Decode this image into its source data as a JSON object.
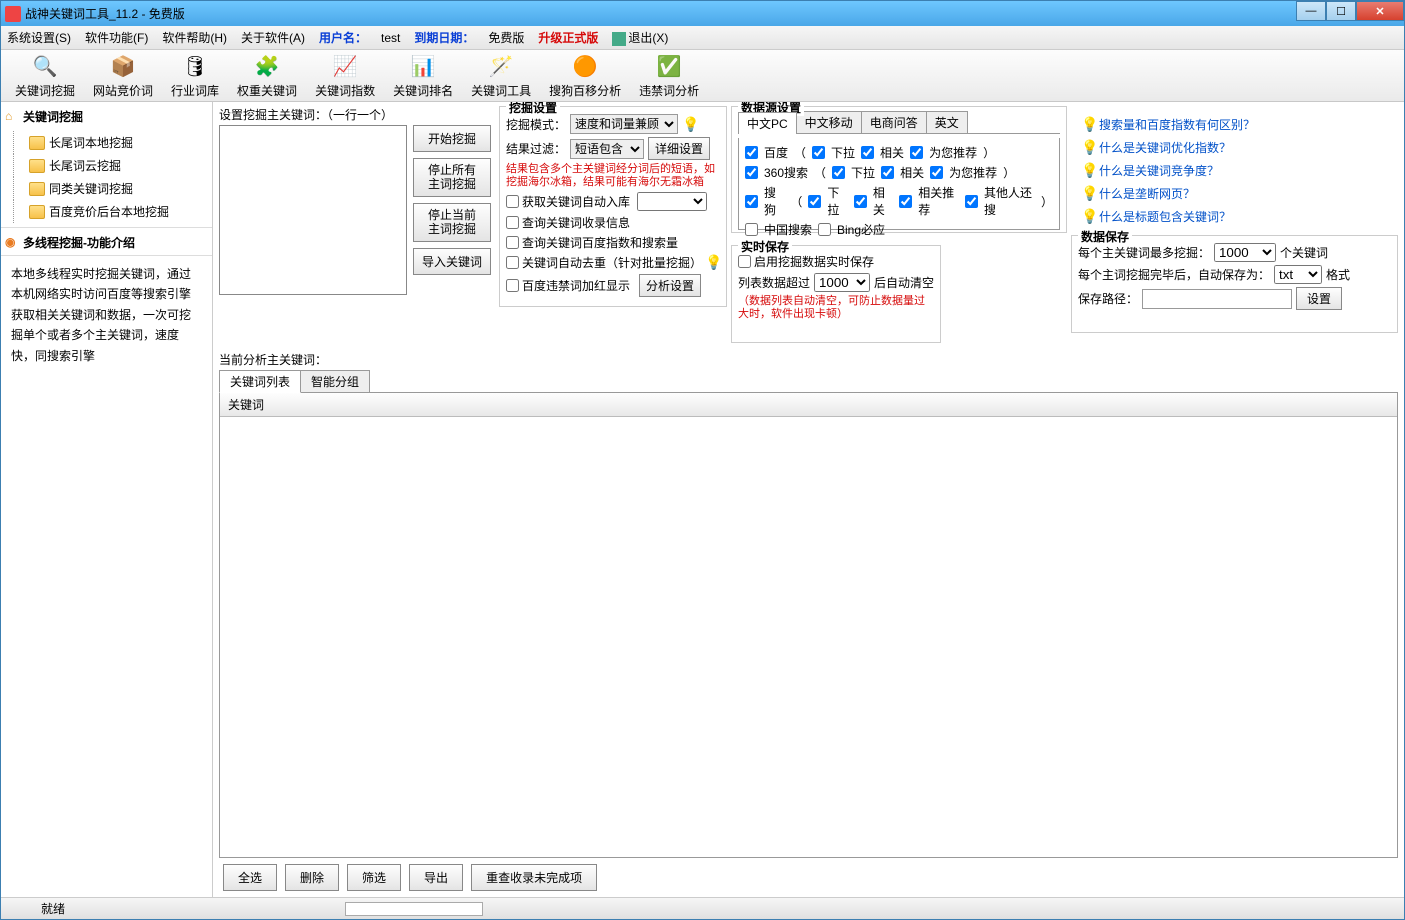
{
  "window": {
    "title": "战神关键词工具_11.2 - 免费版"
  },
  "menubar": {
    "sys": "系统设置(S)",
    "func": "软件功能(F)",
    "help": "软件帮助(H)",
    "about": "关于软件(A)",
    "user_label": "用户名：",
    "user_value": "test",
    "expire_label": "到期日期：",
    "edition": "免费版",
    "upgrade": "升级正式版",
    "exit": "退出(X)"
  },
  "toolbar": [
    {
      "name": "keyword-mining",
      "label": "关键词挖掘",
      "icon": "🔍"
    },
    {
      "name": "site-bid",
      "label": "网站竞价词",
      "icon": "📦"
    },
    {
      "name": "industry-db",
      "label": "行业词库",
      "icon": "🛢"
    },
    {
      "name": "weight-keyword",
      "label": "权重关键词",
      "icon": "🧩"
    },
    {
      "name": "keyword-index",
      "label": "关键词指数",
      "icon": "📈"
    },
    {
      "name": "keyword-rank",
      "label": "关键词排名",
      "icon": "📊"
    },
    {
      "name": "keyword-tool",
      "label": "关键词工具",
      "icon": "🪄"
    },
    {
      "name": "sogou-analysis",
      "label": "搜狗百移分析",
      "icon": "🟠"
    },
    {
      "name": "banned-analysis",
      "label": "违禁词分析",
      "icon": "✅"
    }
  ],
  "sidebar": {
    "title": "关键词挖掘",
    "tree": [
      "长尾词本地挖掘",
      "长尾词云挖掘",
      "同类关键词挖掘",
      "百度竞价后台本地挖掘"
    ],
    "sec2": "多线程挖掘-功能介绍",
    "desc": "本地多线程实时挖掘关键词，通过本机网络实时访问百度等搜索引擎获取相关关键词和数据，一次可挖掘单个或者多个主关键词，速度快，同搜索引擎"
  },
  "col1": {
    "label": "设置挖掘主关键词：（一行一个）",
    "btn_start": "开始挖掘",
    "btn_stop_all": "停止所有\n主词挖掘",
    "btn_stop_cur": "停止当前\n主词挖掘",
    "btn_import": "导入关键词"
  },
  "mining": {
    "legend": "挖掘设置",
    "mode_label": "挖掘模式：",
    "mode_value": "速度和词量兼顾",
    "filter_label": "结果过滤：",
    "filter_value": "短语包含",
    "detail_btn": "详细设置",
    "note": "结果包含多个主关键词经分词后的短语，如挖掘海尔冰箱，结果可能有海尔无霜冰箱",
    "chk_auto_in": "获取关键词自动入库",
    "chk_query_inc": "查询关键词收录信息",
    "chk_query_idx": "查询关键词百度指数和搜索量",
    "chk_dedup": "关键词自动去重（针对批量挖掘）",
    "chk_ban_red": "百度违禁词加红显示",
    "analyze_btn": "分析设置"
  },
  "datasource": {
    "legend": "数据源设置",
    "tabs": [
      "中文PC",
      "中文移动",
      "电商问答",
      "英文"
    ],
    "rows": [
      {
        "main": "百度",
        "dd": true,
        "opts": [
          "下拉",
          "相关",
          "为您推荐"
        ]
      },
      {
        "main": "360搜索",
        "dd": true,
        "opts": [
          "下拉",
          "相关",
          "为您推荐"
        ]
      },
      {
        "main": "搜狗",
        "dd": true,
        "opts": [
          "下拉",
          "相关",
          "相关推荐",
          "其他人还搜"
        ]
      },
      {
        "main": "中国搜索",
        "dd": false,
        "opts": [
          "Bing必应"
        ]
      }
    ]
  },
  "realtime": {
    "legend": "实时保存",
    "chk": "启用挖掘数据实时保存",
    "row2a": "列表数据超过",
    "row2val": "1000",
    "row2b": "后自动清空",
    "note": "（数据列表自动清空，可防止数据量过大时，软件出现卡顿）"
  },
  "datasave": {
    "legend": "数据保存",
    "r1a": "每个主关键词最多挖掘：",
    "r1val": "1000",
    "r1b": "个关键词",
    "r2a": "每个主词挖掘完毕后，自动保存为：",
    "r2val": "txt",
    "r2b": "格式",
    "r3a": "保存路径：",
    "r3btn": "设置"
  },
  "helps": [
    "搜索量和百度指数有何区别？",
    "什么是关键词优化指数？",
    "什么是关键词竞争度？",
    "什么是垄断网页？",
    "什么是标题包含关键词？"
  ],
  "analysis_label": "当前分析主关键词：",
  "tabs2": [
    "关键词列表",
    "智能分组"
  ],
  "grid_header": "关键词",
  "bottom_btns": [
    "全选",
    "删除",
    "筛选",
    "导出",
    "重查收录未完成项"
  ],
  "status": "就绪"
}
